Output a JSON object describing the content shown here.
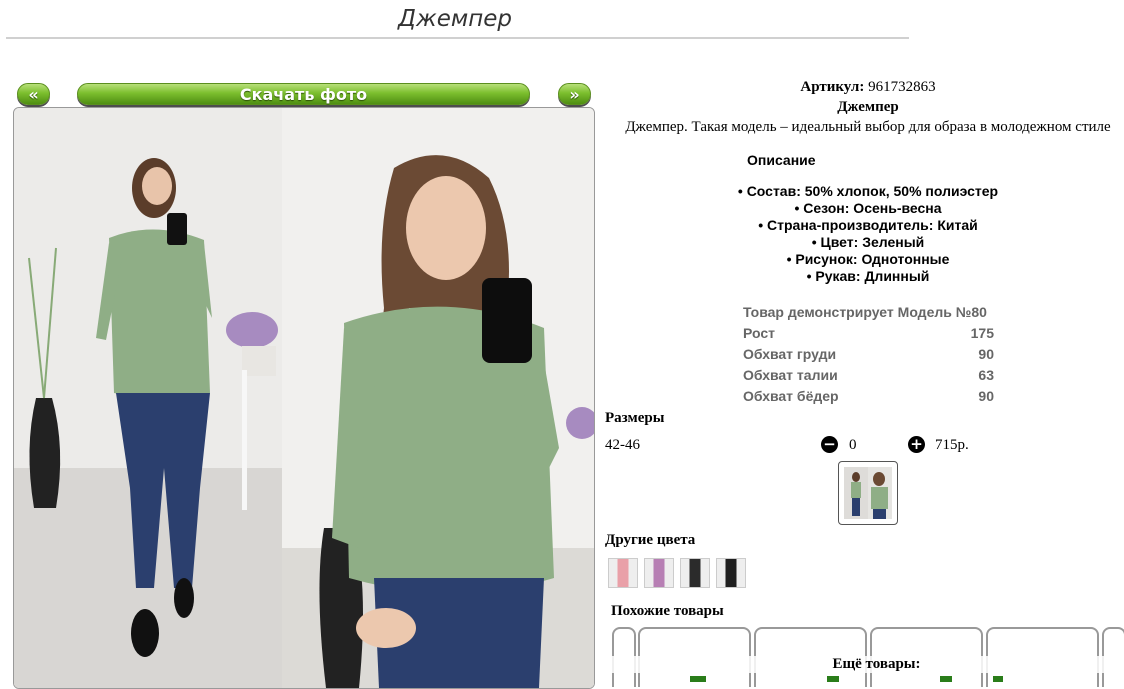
{
  "page": {
    "title": "Джемпер"
  },
  "gallery": {
    "prev_label": "«",
    "download_label": "Скачать фото",
    "next_label": "»",
    "photo_icon": "product-photo"
  },
  "product": {
    "sku_label": "Артикул:",
    "sku_value": "961732863",
    "name": "Джемпер",
    "description": "Джемпер. Такая модель – идеальный выбор для образа в молодежном стиле",
    "description_heading": "Описание",
    "specs": [
      "Состав: 50% хлопок, 50% полиэстер",
      "Сезон: Осень-весна",
      "Страна-производитель: Китай",
      "Цвет: Зеленый",
      "Рисунок: Однотонные",
      "Рукав: Длинный"
    ]
  },
  "model": {
    "heading": "Товар демонстрирует Модель №80",
    "rows": [
      {
        "label": "Рост",
        "value": "175"
      },
      {
        "label": "Обхват груди",
        "value": "90"
      },
      {
        "label": "Обхват талии",
        "value": "63"
      },
      {
        "label": "Обхват бёдер",
        "value": "90"
      }
    ]
  },
  "sizes": {
    "heading": "Размеры",
    "size": "42-46",
    "qty": "0",
    "price": "715р.",
    "minus_icon": "minus-circle-icon",
    "plus_icon": "plus-circle-icon"
  },
  "other_colors": {
    "heading": "Другие цвета",
    "swatch_colors": [
      "#e9a0a8",
      "#b77fb4",
      "#2b2b2b",
      "#1f1f1f"
    ]
  },
  "similar": {
    "heading": "Похожие товары"
  },
  "more": {
    "label": "Ещё товары:"
  },
  "colors": {
    "button_green": "#6fb127",
    "sweater_green": "#8fae86",
    "jeans_blue": "#2b3f6e"
  }
}
